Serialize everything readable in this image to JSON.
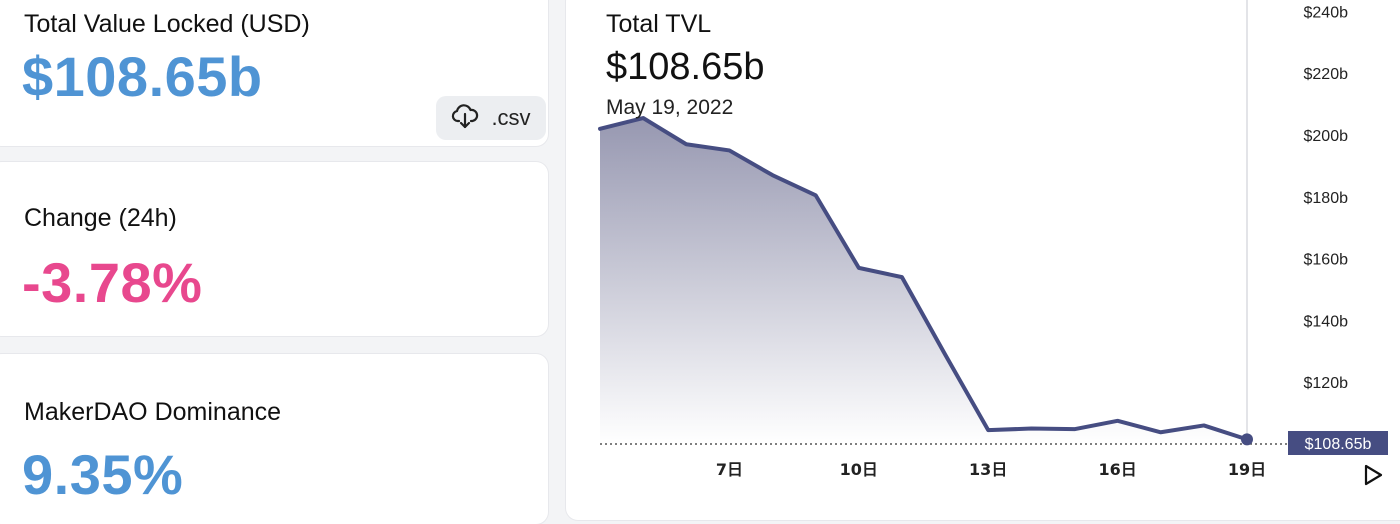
{
  "stats": {
    "tvl": {
      "label": "Total Value Locked (USD)",
      "value": "$108.65b",
      "color": "#4f94d4"
    },
    "change": {
      "label": "Change (24h)",
      "value": "-3.78%",
      "color": "#e8488e"
    },
    "dominance": {
      "label": "MakerDAO Dominance",
      "value": "9.35%",
      "color": "#4f94d4"
    },
    "csv_button": {
      "label": ".csv",
      "icon": "cloud-download-icon"
    }
  },
  "chart_header": {
    "title": "Total TVL",
    "value": "$108.65b",
    "date": "May 19, 2022"
  },
  "play_icon": "play-icon",
  "chart_data": {
    "type": "area",
    "x": [
      4,
      5,
      6,
      7,
      8,
      9,
      10,
      11,
      12,
      13,
      14,
      15,
      16,
      17,
      18,
      19
    ],
    "values": [
      202,
      205.5,
      197,
      195,
      187,
      180.5,
      157,
      154,
      129,
      104.5,
      105,
      104.8,
      107.5,
      103.8,
      106,
      101.5
    ],
    "x_ticks": [
      7,
      10,
      13,
      16,
      19
    ],
    "x_tick_labels": [
      "7日",
      "10日",
      "13日",
      "16日",
      "19日"
    ],
    "y_ticks": [
      120,
      140,
      160,
      180,
      200,
      220,
      240
    ],
    "y_tick_labels": [
      "$120b",
      "$140b",
      "$160b",
      "$180b",
      "$200b",
      "$220b",
      "$240b"
    ],
    "ylim": [
      100,
      240
    ],
    "current_label": "$108.65b",
    "line_color": "#464d82",
    "grid": false
  }
}
